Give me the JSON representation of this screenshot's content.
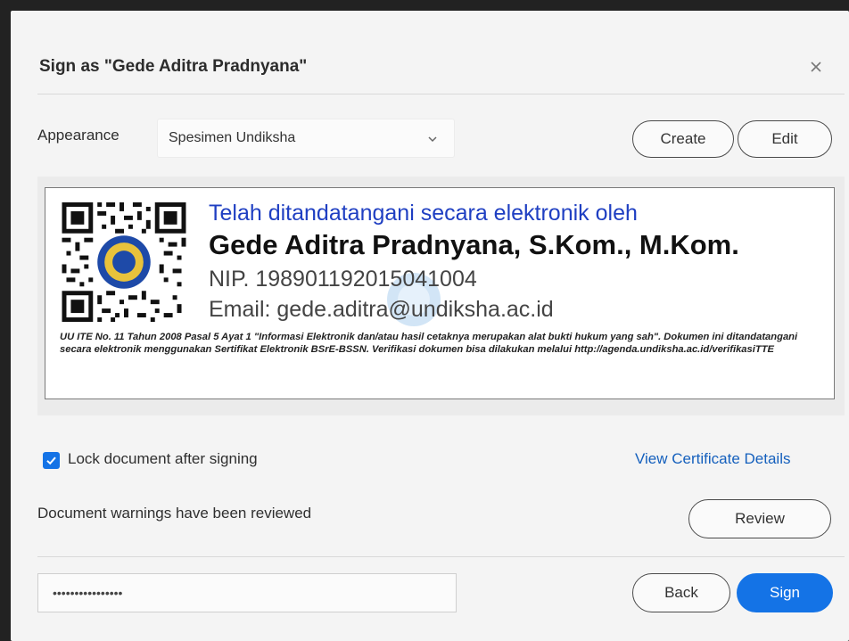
{
  "dialog": {
    "title": "Sign as \"Gede Aditra Pradnyana\"",
    "close_icon": "close-icon"
  },
  "appearance": {
    "label": "Appearance",
    "selected": "Spesimen Undiksha",
    "create_label": "Create",
    "edit_label": "Edit"
  },
  "signature_preview": {
    "line1": "Telah ditandatangani secara elektronik oleh",
    "name": "Gede Aditra Pradnyana, S.Kom., M.Kom.",
    "nip": "NIP. 198901192015041004",
    "email": "Email: gede.aditra@undiksha.ac.id",
    "legal": "UU ITE No. 11 Tahun 2008 Pasal 5 Ayat 1 \"Informasi Elektronik dan/atau hasil cetaknya merupakan alat bukti hukum yang sah\". Dokumen ini ditandatangani secara elektronik menggunakan Sertifikat Elektronik BSrE-BSSN. Verifikasi dokumen bisa dilakukan melalui http://agenda.undiksha.ac.id/verifikasiTTE"
  },
  "options": {
    "lock_label": "Lock document after signing",
    "lock_checked": true,
    "view_certificate_label": "View Certificate Details",
    "warnings_text": "Document warnings have been reviewed",
    "review_label": "Review"
  },
  "footer": {
    "password_value": "••••••••••••••••",
    "back_label": "Back",
    "sign_label": "Sign"
  },
  "colors": {
    "accent": "#1473e6",
    "link": "#1560bd",
    "signature_blue": "#1f3fc2"
  }
}
